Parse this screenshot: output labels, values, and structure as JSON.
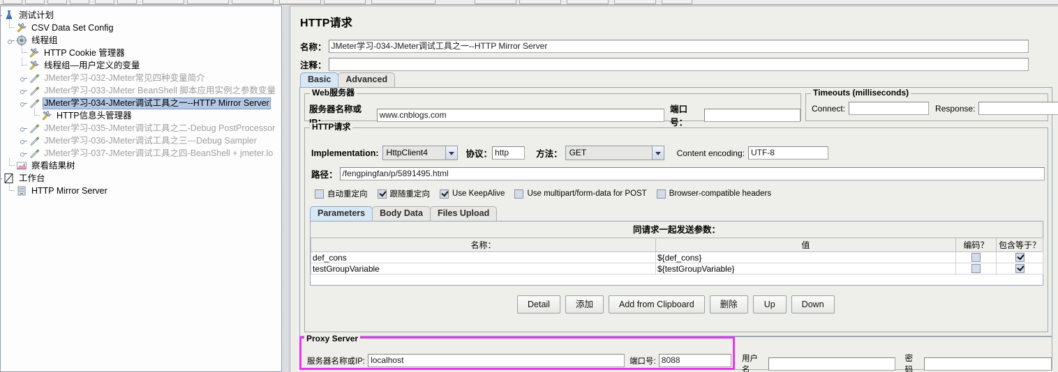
{
  "tree": {
    "items": [
      {
        "label": "测试计划",
        "icon": "test-plan-icon",
        "depth": 0,
        "dim": false,
        "selected": false
      },
      {
        "label": "CSV Data Set Config",
        "icon": "config-element-icon",
        "depth": 1,
        "dim": false,
        "selected": false
      },
      {
        "label": "线程组",
        "icon": "thread-group-icon",
        "depth": 1,
        "dim": false,
        "selected": false
      },
      {
        "label": "HTTP Cookie 管理器",
        "icon": "config-element-icon",
        "depth": 2,
        "dim": false,
        "selected": false
      },
      {
        "label": "线程组—用户定义的变量",
        "icon": "config-element-icon",
        "depth": 2,
        "dim": false,
        "selected": false
      },
      {
        "label": "JMeter学习-032-JMeter常见四种变量简介",
        "icon": "sampler-icon",
        "depth": 2,
        "dim": true,
        "selected": false
      },
      {
        "label": "JMeter学习-033-JMeter BeanShell 脚本应用实例之参数变量",
        "icon": "sampler-icon",
        "depth": 2,
        "dim": true,
        "selected": false
      },
      {
        "label": "JMeter学习-034-JMeter调试工具之一--HTTP Mirror Server",
        "icon": "sampler-icon",
        "depth": 2,
        "dim": false,
        "selected": true
      },
      {
        "label": "HTTP信息头管理器",
        "icon": "config-element-icon",
        "depth": 3,
        "dim": false,
        "selected": false
      },
      {
        "label": "JMeter学习-035-JMeter调试工具之二-Debug PostProcessor",
        "icon": "sampler-icon",
        "depth": 2,
        "dim": true,
        "selected": false
      },
      {
        "label": "JMeter学习-036-JMeter调试工具之三---Debug Sampler",
        "icon": "sampler-icon",
        "depth": 2,
        "dim": true,
        "selected": false
      },
      {
        "label": "JMeter学习-037-JMeter调试工具之四-BeanShell + jmeter.lo",
        "icon": "sampler-icon",
        "depth": 2,
        "dim": true,
        "selected": false
      },
      {
        "label": "察看结果树",
        "icon": "listener-icon",
        "depth": 1,
        "dim": false,
        "selected": false
      },
      {
        "label": "工作台",
        "icon": "workbench-icon",
        "depth": 0,
        "dim": false,
        "selected": false
      },
      {
        "label": "HTTP Mirror Server",
        "icon": "mirror-server-icon",
        "depth": 1,
        "dim": false,
        "selected": false
      }
    ]
  },
  "right": {
    "title": "HTTP请求",
    "name_label": "名称：",
    "name_value": "JMeter学习-034-JMeter调试工具之一--HTTP Mirror Server",
    "comment_label": "注释：",
    "comment_value": "",
    "tabs": [
      {
        "label": "Basic",
        "active": true
      },
      {
        "label": "Advanced",
        "active": false
      }
    ],
    "web_server": {
      "title": "Web服务器",
      "host_label": "服务器名称或IP：",
      "host_value": "www.cnblogs.com",
      "port_label": "端口号：",
      "port_value": ""
    },
    "timeouts": {
      "title": "Timeouts (milliseconds)",
      "connect_label": "Connect:",
      "connect_value": "",
      "response_label": "Response:",
      "response_value": ""
    },
    "http_request": {
      "title": "HTTP请求",
      "implementation_label": "Implementation:",
      "implementation_value": "HttpClient4",
      "protocol_label": "协议：",
      "protocol_value": "http",
      "method_label": "方法：",
      "method_value": "GET",
      "encoding_label": "Content encoding:",
      "encoding_value": "UTF-8",
      "path_label": "路径：",
      "path_value": "/fengpingfan/p/5891495.html",
      "checkboxes": [
        {
          "label": "自动重定向",
          "checked": false
        },
        {
          "label": "跟随重定向",
          "checked": true
        },
        {
          "label": "Use KeepAlive",
          "checked": true
        },
        {
          "label": "Use multipart/form-data for POST",
          "checked": false
        },
        {
          "label": "Browser-compatible headers",
          "checked": false
        }
      ],
      "inner_tabs": [
        {
          "label": "Parameters",
          "active": true
        },
        {
          "label": "Body Data",
          "active": false
        },
        {
          "label": "Files Upload",
          "active": false
        }
      ]
    },
    "params_table": {
      "banner": "同请求一起发送参数：",
      "columns": [
        "名称：",
        "值",
        "编码？",
        "包含等于？"
      ],
      "rows": [
        {
          "name": "def_cons",
          "value": "${def_cons}",
          "encode": false,
          "include_equals": true
        },
        {
          "name": "testGroupVariable",
          "value": "${testGroupVariable}",
          "encode": false,
          "include_equals": true
        }
      ]
    },
    "buttons": [
      "Detail",
      "添加",
      "Add from Clipboard",
      "删除",
      "Up",
      "Down"
    ],
    "proxy": {
      "title": "Proxy Server",
      "highlight_color": "#e836e8",
      "host_label": "服务器名称或IP:",
      "host_value": "localhost",
      "port_label": "端口号:",
      "port_value": "8088",
      "user_label": "用户名",
      "user_value": "",
      "pass_label": "密码",
      "pass_value": ""
    }
  }
}
